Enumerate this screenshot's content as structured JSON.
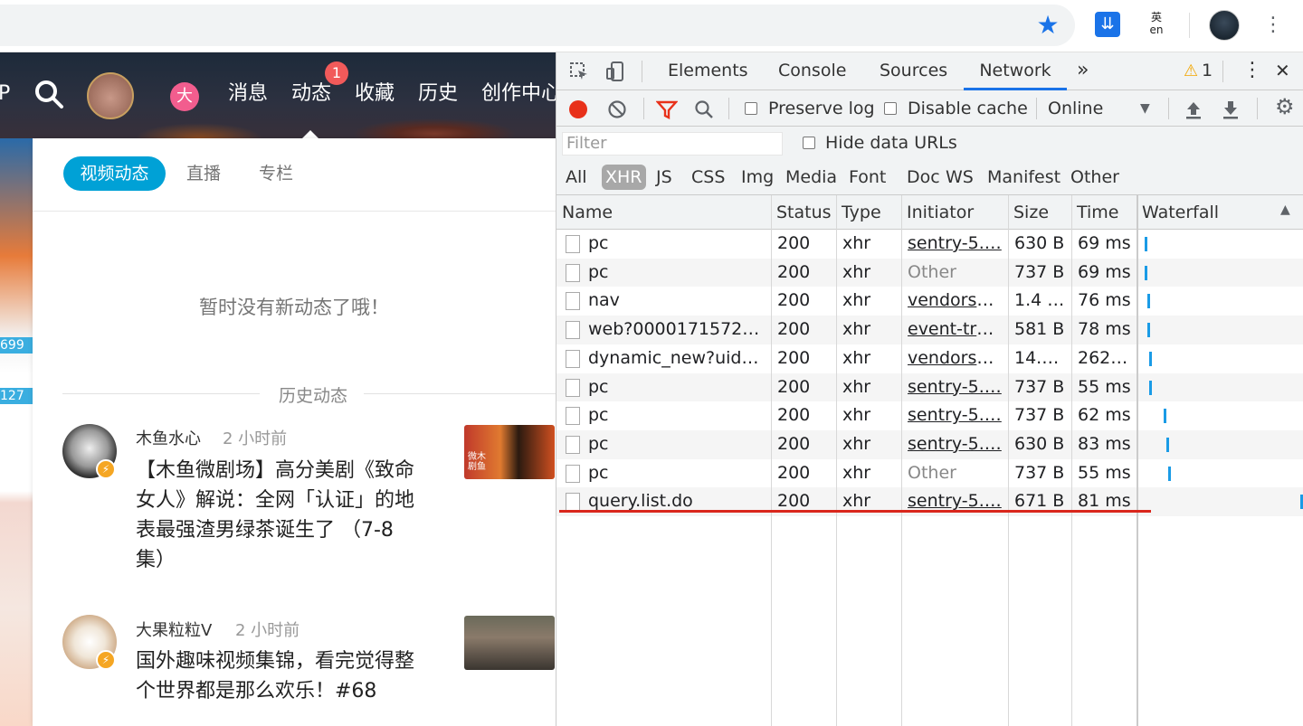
{
  "browser": {
    "bookmark_icon": "star-icon",
    "extensions": [
      "download-extension-icon",
      "translate-extension-icon"
    ],
    "ext2_label": "英\nen",
    "menu_icon": "kebab-menu-icon"
  },
  "site": {
    "header": {
      "cut_text": "P",
      "badge": "大",
      "nav": [
        "消息",
        "动态",
        "收藏",
        "历史",
        "创作中心"
      ],
      "notification_count": "1"
    },
    "left_badges": [
      "699",
      "127"
    ],
    "panel": {
      "tabs": [
        "视频动态",
        "直播",
        "专栏"
      ],
      "empty_message": "暂时没有新动态了哦！",
      "history_label": "历史动态",
      "feed": [
        {
          "author": "木鱼水心",
          "time": "2 小时前",
          "title_lines": [
            "【木鱼微剧场】高分美剧《致命",
            "女人》解说：全网「认证」的地",
            "表最强渣男绿茶诞生了 （7-8",
            "集）"
          ],
          "thumb_text": "微木\n剧鱼"
        },
        {
          "author": "大果粒粒V",
          "time": "2 小时前",
          "title_lines": [
            "国外趣味视频集锦，看完觉得整",
            "个世界都是那么欢乐！#68"
          ]
        }
      ]
    }
  },
  "devtools": {
    "tabs": [
      "Elements",
      "Console",
      "Sources",
      "Network"
    ],
    "more_tabs": "»",
    "warning_count": "1",
    "active_tab": "Network",
    "toolbar": {
      "preserve_log": "Preserve log",
      "disable_cache": "Disable cache",
      "throttle": "Online"
    },
    "filter": {
      "placeholder": "Filter",
      "hide_data_urls": "Hide data URLs",
      "types": [
        "All",
        "XHR",
        "JS",
        "CSS",
        "Img",
        "Media",
        "Font",
        "Doc",
        "WS",
        "Manifest",
        "Other"
      ],
      "active_type": "XHR"
    },
    "columns": [
      "Name",
      "Status",
      "Type",
      "Initiator",
      "Size",
      "Time",
      "Waterfall"
    ],
    "rows": [
      {
        "name": "pc",
        "status": "200",
        "type": "xhr",
        "initiator": "sentry-5.…",
        "initiator_link": true,
        "size": "630 B",
        "time": "69 ms",
        "waterfall_start": 0.02
      },
      {
        "name": "pc",
        "status": "200",
        "type": "xhr",
        "initiator": "Other",
        "initiator_link": false,
        "size": "737 B",
        "time": "69 ms",
        "waterfall_start": 0.02
      },
      {
        "name": "nav",
        "status": "200",
        "type": "xhr",
        "initiator": "vendors~…",
        "initiator_link": true,
        "size": "1.4 …",
        "time": "76 ms",
        "waterfall_start": 0.04
      },
      {
        "name": "web?00001715721…",
        "status": "200",
        "type": "xhr",
        "initiator": "event-tra…",
        "initiator_link": true,
        "size": "581 B",
        "time": "78 ms",
        "waterfall_start": 0.04
      },
      {
        "name": "dynamic_new?uid=…",
        "status": "200",
        "type": "xhr",
        "initiator": "vendors~…",
        "initiator_link": true,
        "size": "14.…",
        "time": "262…",
        "waterfall_start": 0.05
      },
      {
        "name": "pc",
        "status": "200",
        "type": "xhr",
        "initiator": "sentry-5.…",
        "initiator_link": true,
        "size": "737 B",
        "time": "55 ms",
        "waterfall_start": 0.05
      },
      {
        "name": "pc",
        "status": "200",
        "type": "xhr",
        "initiator": "sentry-5.…",
        "initiator_link": true,
        "size": "737 B",
        "time": "62 ms",
        "waterfall_start": 0.14
      },
      {
        "name": "pc",
        "status": "200",
        "type": "xhr",
        "initiator": "sentry-5.…",
        "initiator_link": true,
        "size": "630 B",
        "time": "83 ms",
        "waterfall_start": 0.16
      },
      {
        "name": "pc",
        "status": "200",
        "type": "xhr",
        "initiator": "Other",
        "initiator_link": false,
        "size": "737 B",
        "time": "55 ms",
        "waterfall_start": 0.17
      },
      {
        "name": "query.list.do",
        "status": "200",
        "type": "xhr",
        "initiator": "sentry-5.…",
        "initiator_link": true,
        "size": "671 B",
        "time": "81 ms",
        "waterfall_start": 0.99
      }
    ],
    "highlighted_row": 4,
    "colors": {
      "accent": "#1a73e8",
      "record": "#e8311a",
      "highlight": "#d9261c",
      "waterfall": "#1a9be6"
    }
  }
}
